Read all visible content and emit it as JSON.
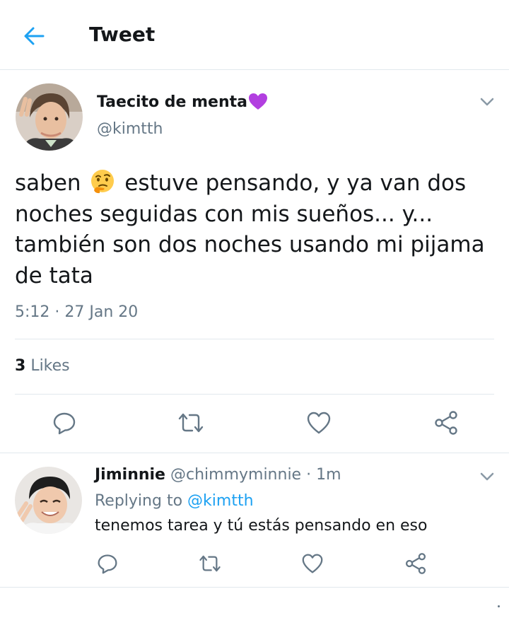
{
  "header": {
    "title": "Tweet",
    "back_icon": "arrow-left-icon",
    "accent": "#1da1f2"
  },
  "tweet": {
    "author_name": "Taecito de menta",
    "author_emoji": "purple-heart-icon",
    "handle": "@kimtth",
    "text_before_emoji": "saben",
    "text_emoji": "thinking-face-icon",
    "text_after_emoji": "estuve pensando, y ya van dos noches seguidas con mis sueños... y... también son dos noches usando mi pijama de tata",
    "timestamp": "5:12 · 27 Jan 20",
    "likes_count": "3",
    "likes_label": "Likes"
  },
  "reply": {
    "author_name": "Jiminnie",
    "handle_time": "@chimmyminnie · 1m",
    "replying_prefix": "Replying to",
    "replying_mention": "@kimtth",
    "text": "tenemos tarea y tú estás pensando en eso"
  },
  "actions": [
    "reply-icon",
    "retweet-icon",
    "like-icon",
    "share-icon"
  ],
  "colors": {
    "text": "#14171a",
    "secondary": "#657786",
    "accent": "#1da1f2",
    "divider": "#e1e8ed"
  }
}
